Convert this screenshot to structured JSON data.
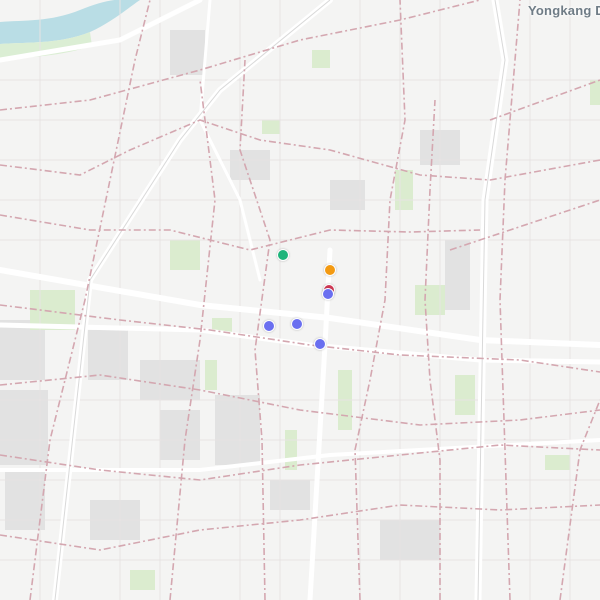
{
  "map": {
    "place_label": "Yongkang D",
    "markers": [
      {
        "name": "marker-green",
        "color": "#1db47a"
      },
      {
        "name": "marker-orange",
        "color": "#f39a12"
      },
      {
        "name": "marker-red",
        "color": "#d23a55"
      },
      {
        "name": "marker-blue-1",
        "color": "#6a6ff0"
      },
      {
        "name": "marker-blue-2",
        "color": "#6a6ff0"
      },
      {
        "name": "marker-blue-3",
        "color": "#6a6ff0"
      },
      {
        "name": "marker-blue-4",
        "color": "#6a6ff0"
      }
    ]
  }
}
